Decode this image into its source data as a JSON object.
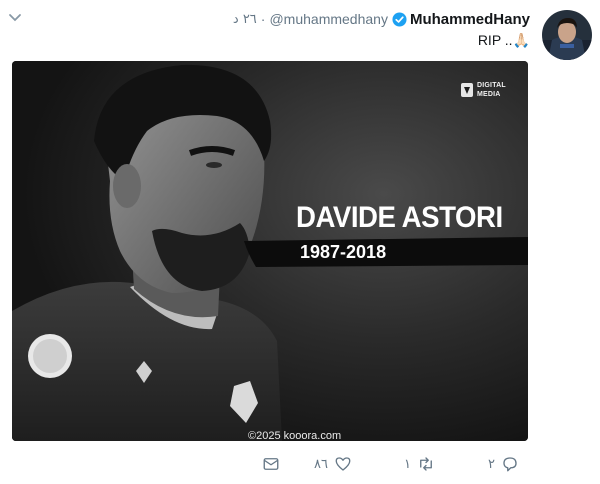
{
  "tweet": {
    "display_name": "MuhammedHany",
    "handle": "@muhammedhany",
    "separator": "·",
    "time": "٢٦ د",
    "text": "RIP ..🙏🏻",
    "verified": true
  },
  "media": {
    "player_name": "DAVIDE ASTORI",
    "years": "1987-2018",
    "logo_line1": "DIGITAL",
    "logo_line2": "MEDIA",
    "watermark": "©2025 kooora.com"
  },
  "actions": {
    "reply_count": "٢",
    "retweet_count": "١",
    "like_count": "٨٦"
  },
  "colors": {
    "verified": "#1da1f2",
    "icon": "#657786",
    "text": "#14171a"
  }
}
